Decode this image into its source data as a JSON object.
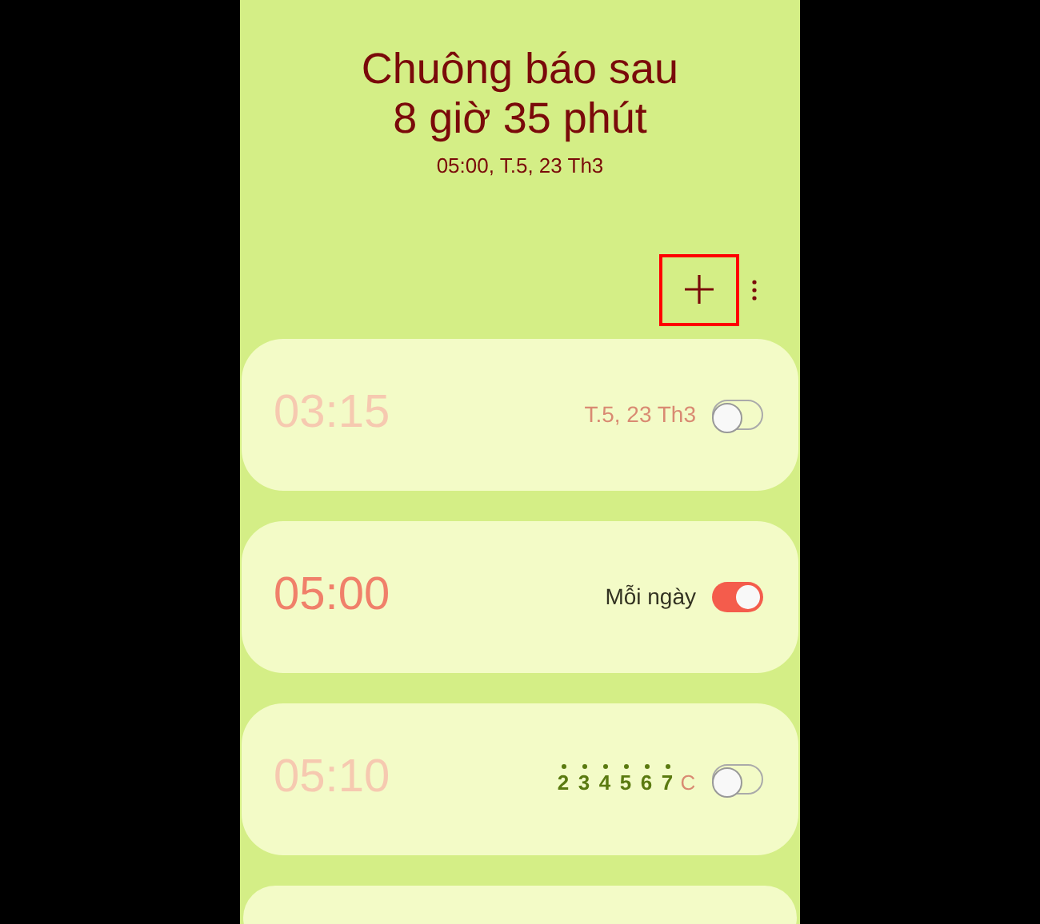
{
  "header": {
    "title_line_1": "Chuông báo sau",
    "title_line_2": "8 giờ 35 phút",
    "next_alarm": "05:00, T.5, 23 Th3"
  },
  "toolbar": {
    "add_highlighted": true
  },
  "alarms": [
    {
      "time": "03:15",
      "kind": "date",
      "label": "T.5, 23 Th3",
      "on": false
    },
    {
      "time": "05:00",
      "kind": "repeat",
      "label": "Mỗi ngày",
      "on": true
    },
    {
      "time": "05:10",
      "kind": "days",
      "days": [
        {
          "label": "2",
          "selected": true
        },
        {
          "label": "3",
          "selected": true
        },
        {
          "label": "4",
          "selected": true
        },
        {
          "label": "5",
          "selected": true
        },
        {
          "label": "6",
          "selected": true
        },
        {
          "label": "7",
          "selected": true
        },
        {
          "label": "C",
          "selected": false
        }
      ],
      "on": false
    }
  ]
}
